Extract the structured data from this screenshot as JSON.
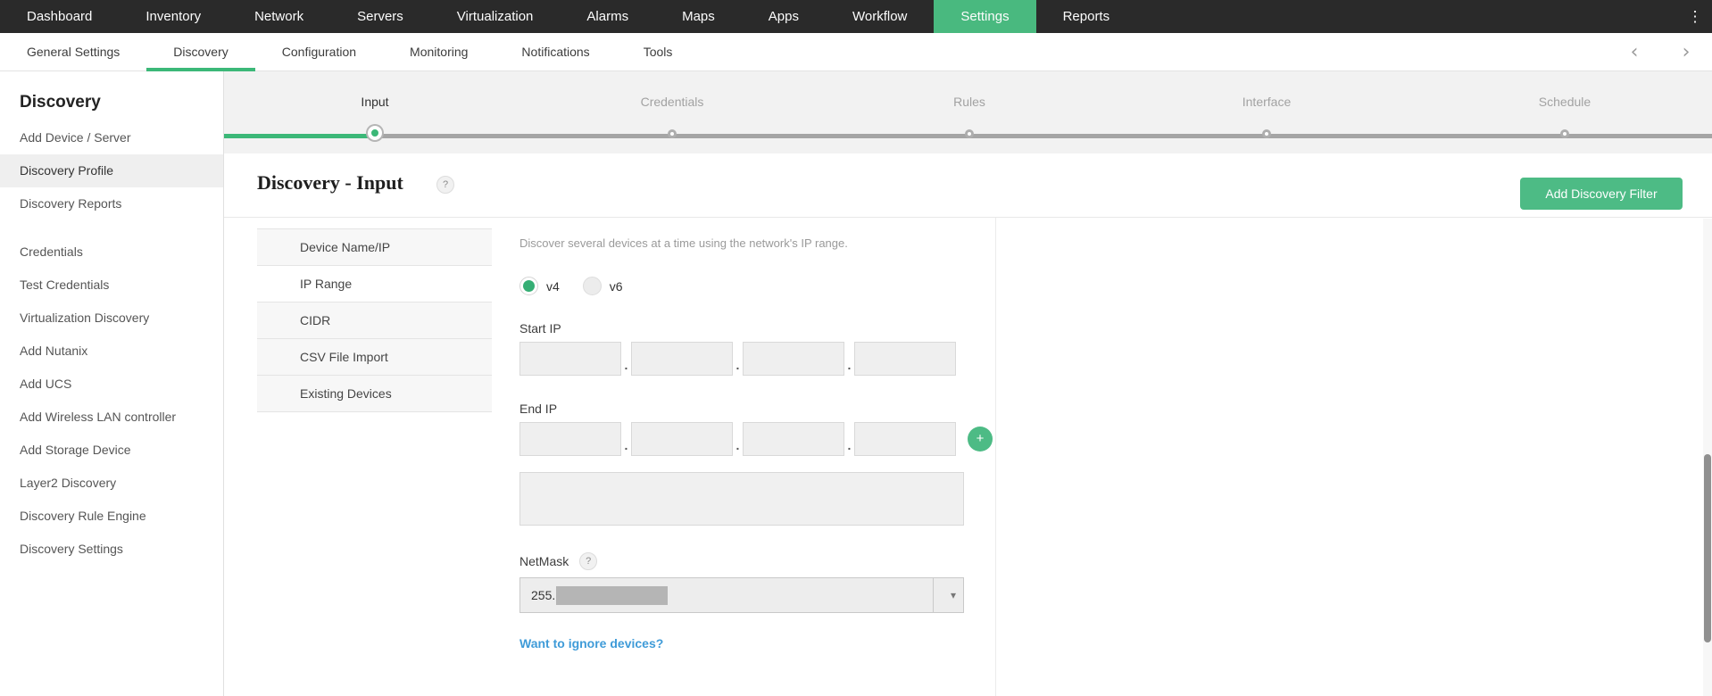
{
  "top_nav": {
    "items": [
      "Dashboard",
      "Inventory",
      "Network",
      "Servers",
      "Virtualization",
      "Alarms",
      "Maps",
      "Apps",
      "Workflow",
      "Settings",
      "Reports"
    ],
    "active": "Settings"
  },
  "settings_nav": {
    "items": [
      "General Settings",
      "Discovery",
      "Configuration",
      "Monitoring",
      "Notifications",
      "Tools"
    ],
    "active": "Discovery"
  },
  "sidebar": {
    "title": "Discovery",
    "items": [
      "Add Device / Server",
      "Discovery Profile",
      "Discovery Reports",
      "Credentials",
      "Test Credentials",
      "Virtualization Discovery",
      "Add Nutanix",
      "Add UCS",
      "Add Wireless LAN controller",
      "Add Storage Device",
      "Layer2 Discovery",
      "Discovery Rule Engine",
      "Discovery Settings"
    ],
    "active": "Discovery Profile"
  },
  "stepper": {
    "steps": [
      "Input",
      "Credentials",
      "Rules",
      "Interface",
      "Schedule"
    ],
    "active": "Input"
  },
  "content": {
    "title": "Discovery - Input",
    "add_filter_button": "Add Discovery Filter",
    "method_tabs": [
      "Device Name/IP",
      "IP Range",
      "CIDR",
      "CSV File Import",
      "Existing Devices"
    ],
    "active_tab": "IP Range",
    "form": {
      "description": "Discover several devices at a time using the network's IP range.",
      "ip_version_options": [
        "v4",
        "v6"
      ],
      "ip_version_selected": "v4",
      "start_ip_label": "Start IP",
      "end_ip_label": "End IP",
      "netmask_label": "NetMask",
      "netmask_value": "255.",
      "ignore_link": "Want to ignore devices?"
    }
  },
  "icons": {
    "kebab": "⋮",
    "chevron_left": "‹",
    "chevron_right": "›",
    "help": "?",
    "plus": "+",
    "caret_down": "▾",
    "octet_separator": "."
  },
  "colors": {
    "accent_green": "#3cb878",
    "button_green": "#4dbb85",
    "nav_dark": "#2a2a2a",
    "link_blue": "#3f9bd8",
    "redaction_gray": "#b5b5b5"
  }
}
